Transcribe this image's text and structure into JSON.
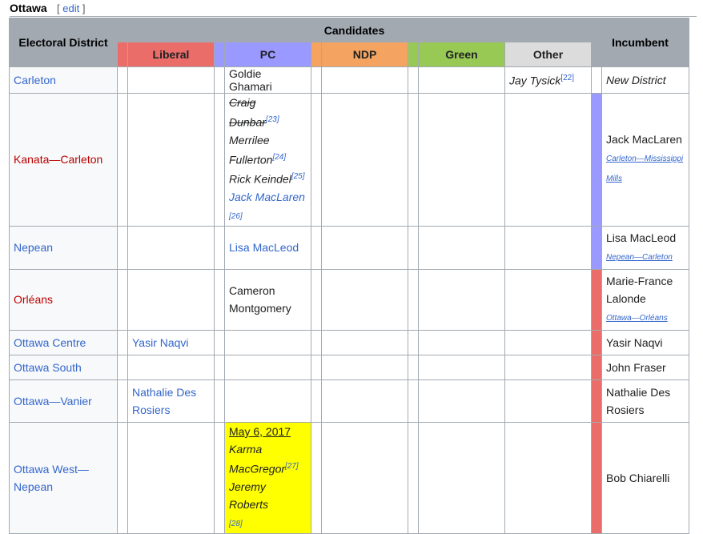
{
  "section": {
    "title": "Ottawa",
    "edit_open": "[",
    "edit_label": "edit",
    "edit_close": "]"
  },
  "headers": {
    "district": "Electoral District",
    "candidates": "Candidates",
    "incumbent": "Incumbent",
    "parties": [
      "Liberal",
      "PC",
      "NDP",
      "Green",
      "Other"
    ]
  },
  "party_colors": {
    "liberal": "#ea6d6a",
    "pc": "#9999ff",
    "ndp": "#f4a460",
    "green": "#99c955",
    "other": "#dcdcdc"
  },
  "rows": [
    {
      "district": "Carleton",
      "liberal": "",
      "pc": "Goldie Ghamari",
      "other": "Jay Tysick",
      "other_ref": "[22]",
      "incumbent": "New District"
    },
    {
      "district": "Kanata—Carleton",
      "pc": [
        "Craig Dunbar",
        "Merrilee Fullerton",
        "Rick Keindel",
        "Jack MacLaren"
      ],
      "pc_refs": [
        "[23]",
        "[24]",
        "[25]",
        "[26]"
      ],
      "incumbent": "Jack MacLaren",
      "incumbent_note": "Carleton—Mississippi Mills"
    },
    {
      "district": "Nepean",
      "pc": "Lisa MacLeod",
      "incumbent": "Lisa MacLeod",
      "incumbent_note": "Nepean—Carleton"
    },
    {
      "district": "Orléans",
      "pc": "Cameron Montgomery",
      "incumbent": "Marie-France Lalonde",
      "incumbent_note": "Ottawa—Orléans"
    },
    {
      "district": "Ottawa Centre",
      "liberal": "Yasir Naqvi",
      "incumbent": "Yasir Naqvi"
    },
    {
      "district": "Ottawa South",
      "incumbent": "John Fraser"
    },
    {
      "district": "Ottawa—Vanier",
      "liberal": "Nathalie Des Rosiers",
      "incumbent": "Nathalie Des Rosiers"
    },
    {
      "district": "Ottawa West—Nepean",
      "pc_date": "May 6, 2017",
      "pc": [
        "Karma MacGregor",
        "Jeremy Roberts"
      ],
      "pc_refs": [
        "[27]",
        "[28]"
      ],
      "incumbent": "Bob Chiarelli"
    }
  ]
}
